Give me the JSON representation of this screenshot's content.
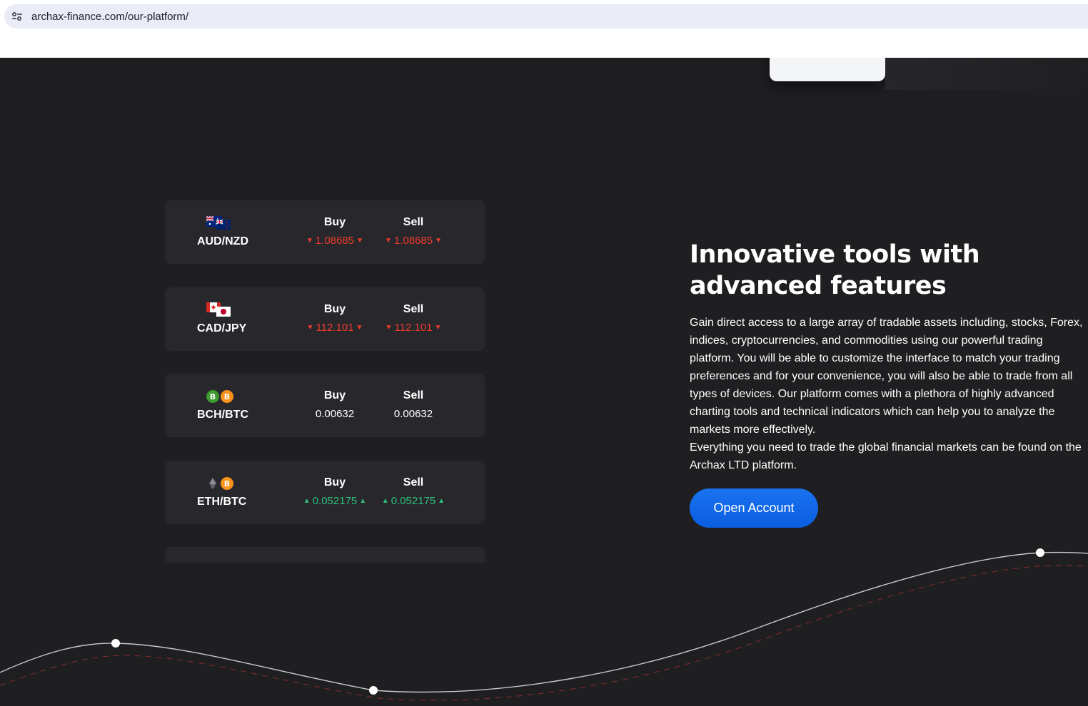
{
  "browser": {
    "url": "archax-finance.com/our-platform/",
    "site_info_icon": "tune-icon"
  },
  "tickers": [
    {
      "pair": "AUD/NZD",
      "icons": [
        "australia-flag-icon",
        "new-zealand-flag-icon"
      ],
      "buy_label": "Buy",
      "sell_label": "Sell",
      "buy": "1.08685",
      "sell": "1.08685",
      "direction": "down"
    },
    {
      "pair": "CAD/JPY",
      "icons": [
        "canada-flag-icon",
        "japan-flag-icon"
      ],
      "buy_label": "Buy",
      "sell_label": "Sell",
      "buy": "112.101",
      "sell": "112.101",
      "direction": "down"
    },
    {
      "pair": "BCH/BTC",
      "icons": [
        "bitcoin-cash-icon",
        "bitcoin-icon"
      ],
      "buy_label": "Buy",
      "sell_label": "Sell",
      "buy": "0.00632",
      "sell": "0.00632",
      "direction": "none"
    },
    {
      "pair": "ETH/BTC",
      "icons": [
        "ethereum-icon",
        "bitcoin-icon"
      ],
      "buy_label": "Buy",
      "sell_label": "Sell",
      "buy": "0.052175",
      "sell": "0.052175",
      "direction": "up"
    }
  ],
  "main": {
    "headline": "Innovative tools with advanced features",
    "paragraph1": "Gain direct access to a large array of tradable assets including, stocks, Forex, indices, cryptocurrencies, and commodities using our powerful trading platform. You will be able to customize the interface to match your trading preferences and for your convenience, you will also be able to trade from all types of devices. Our platform comes with a plethora of highly advanced charting tools and technical indicators which can help you to analyze the markets more effectively.",
    "paragraph2": "Everything you need to trade the global financial markets can be found on the Archax LTD platform.",
    "cta_label": "Open Account"
  },
  "colors": {
    "background": "#1f1f22",
    "card": "#28282c",
    "down": "#ee3a2c",
    "up": "#2ec07c",
    "button": "#0a5de0"
  }
}
